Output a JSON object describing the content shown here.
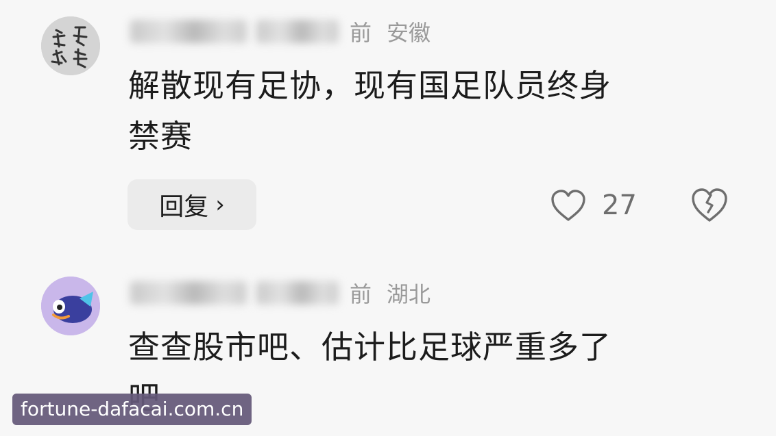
{
  "comments": [
    {
      "meta_suffix": "前",
      "region": "安徽",
      "text_line1": "解散现有足协，现有国足队员终身",
      "text_line2": "禁赛",
      "reply_label": "回复",
      "reply_chevron": "›",
      "like_count": "27",
      "avatar_icon": "calligraphy-avatar-icon"
    },
    {
      "meta_suffix": "前",
      "region": "湖北",
      "text_line1": "查查股市吧、估计比足球严重多了",
      "text_line2": "吧",
      "avatar_icon": "fish-avatar-icon"
    }
  ],
  "watermark": "fortune-dafacai.com.cn",
  "colors": {
    "background": "#f7f7f7",
    "text": "#1c1c1c",
    "meta": "#9a9a9a",
    "reply_bg": "#ebebeb",
    "watermark_bg": "#645878"
  }
}
